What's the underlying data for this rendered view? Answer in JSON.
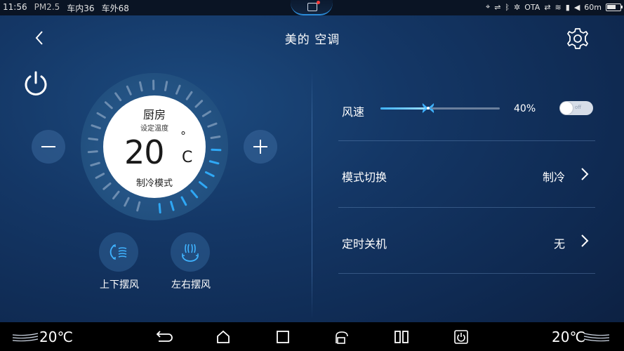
{
  "status_bar": {
    "time": "11:56",
    "pm25": "PM2.5",
    "car_inside": "车内36",
    "car_outside": "车外68",
    "ota": "OTA",
    "battery_text": "60m"
  },
  "header": {
    "title": "美的 空调"
  },
  "dial": {
    "room": "厨房",
    "set_label": "设定温度",
    "temperature": "20",
    "degree_symbol": "°",
    "unit": "C",
    "mode_label": "制冷模式",
    "active_ticks": 8,
    "total_ticks": 30
  },
  "swing": {
    "updown_label": "上下摆风",
    "leftright_label": "左右摆风"
  },
  "fan": {
    "label": "风速",
    "value_text": "40%",
    "value": 0.4,
    "toggle_state": "off"
  },
  "mode_row": {
    "label": "模式切换",
    "value": "制冷"
  },
  "timer_row": {
    "label": "定时关机",
    "value": "无"
  },
  "navbar": {
    "left_temp": "20℃",
    "right_temp": "20℃"
  },
  "colors": {
    "accent": "#2fa8f5",
    "background": "#143766",
    "dial_ring": "#22507f"
  }
}
